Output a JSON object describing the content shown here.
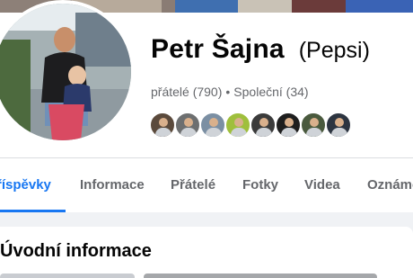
{
  "profile": {
    "name": "Petr Šajna",
    "nickname": "(Pepsi)",
    "friends_label": "přátelé (790)",
    "separator": "•",
    "mutual_label": "Společní (34)"
  },
  "mini_avatars": [
    {
      "name": "friend-avatar-1",
      "color": "#5b4a3c"
    },
    {
      "name": "friend-avatar-2",
      "color": "#6d6f70"
    },
    {
      "name": "friend-avatar-3",
      "color": "#7b8fa3"
    },
    {
      "name": "friend-avatar-4",
      "color": "#9fbf3c"
    },
    {
      "name": "friend-avatar-5",
      "color": "#3b3b3b"
    },
    {
      "name": "friend-avatar-6",
      "color": "#1e1e1e"
    },
    {
      "name": "friend-avatar-7",
      "color": "#4a5a3e"
    },
    {
      "name": "friend-avatar-8",
      "color": "#2c3440"
    }
  ],
  "tabs": [
    {
      "label": "říspěvky",
      "active": true
    },
    {
      "label": "Informace",
      "active": false
    },
    {
      "label": "Přátelé",
      "active": false
    },
    {
      "label": "Fotky",
      "active": false
    },
    {
      "label": "Videa",
      "active": false
    },
    {
      "label": "Oznámе",
      "active": false
    }
  ],
  "intro": {
    "title": "Úvodní informace"
  },
  "colors": {
    "accent": "#1877f2",
    "muted_text": "#65676b",
    "primary_text": "#050505",
    "page_bg": "#f0f2f5"
  }
}
